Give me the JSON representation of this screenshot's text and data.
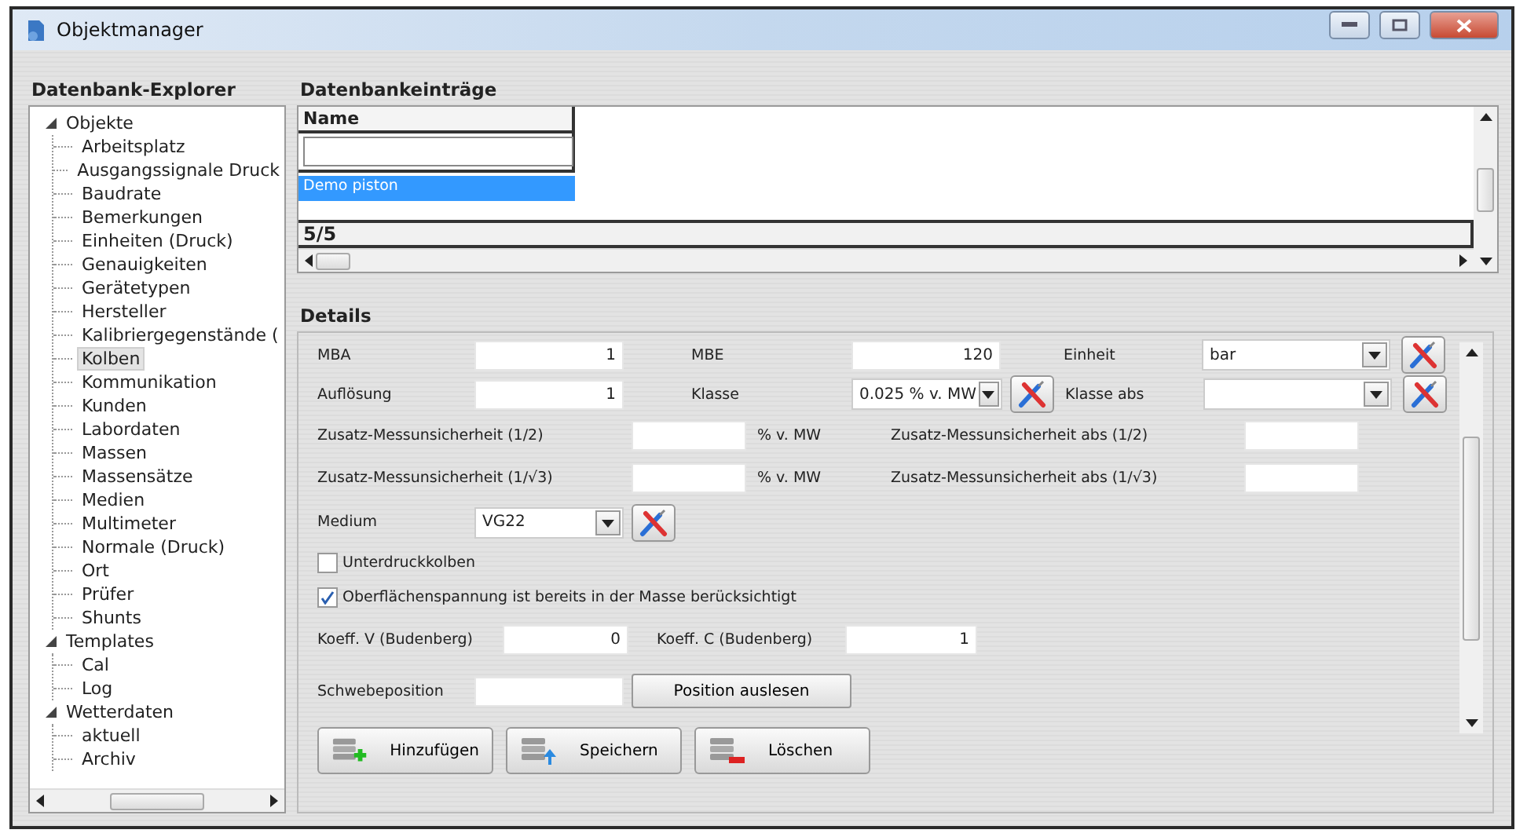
{
  "window": {
    "title": "Objektmanager"
  },
  "explorer": {
    "title": "Datenbank-Explorer",
    "tree": [
      {
        "label": "Objekte",
        "expanded": true,
        "selected": false,
        "children": [
          {
            "label": "Arbeitsplatz",
            "selected": false
          },
          {
            "label": "Ausgangssignale Druck",
            "selected": false
          },
          {
            "label": "Baudrate",
            "selected": false
          },
          {
            "label": "Bemerkungen",
            "selected": false
          },
          {
            "label": "Einheiten (Druck)",
            "selected": false
          },
          {
            "label": "Genauigkeiten",
            "selected": false
          },
          {
            "label": "Gerätetypen",
            "selected": false
          },
          {
            "label": "Hersteller",
            "selected": false
          },
          {
            "label": "Kalibriergegenstände (",
            "selected": false
          },
          {
            "label": "Kolben",
            "selected": true
          },
          {
            "label": "Kommunikation",
            "selected": false
          },
          {
            "label": "Kunden",
            "selected": false
          },
          {
            "label": "Labordaten",
            "selected": false
          },
          {
            "label": "Massen",
            "selected": false
          },
          {
            "label": "Massensätze",
            "selected": false
          },
          {
            "label": "Medien",
            "selected": false
          },
          {
            "label": "Multimeter",
            "selected": false
          },
          {
            "label": "Normale (Druck)",
            "selected": false
          },
          {
            "label": "Ort",
            "selected": false
          },
          {
            "label": "Prüfer",
            "selected": false
          },
          {
            "label": "Shunts",
            "selected": false
          }
        ]
      },
      {
        "label": "Templates",
        "expanded": true,
        "selected": false,
        "children": [
          {
            "label": "Cal",
            "selected": false
          },
          {
            "label": "Log",
            "selected": false
          }
        ]
      },
      {
        "label": "Wetterdaten",
        "expanded": true,
        "selected": false,
        "children": [
          {
            "label": "aktuell",
            "selected": false
          },
          {
            "label": "Archiv",
            "selected": false
          }
        ]
      }
    ]
  },
  "entries": {
    "title": "Datenbankeinträge",
    "columns": [
      "Name"
    ],
    "rows": [
      {
        "name": "Demo piston",
        "selected": true
      }
    ],
    "counter": "5/5"
  },
  "details": {
    "title": "Details",
    "mba": {
      "label": "MBA",
      "value": "1"
    },
    "mbe": {
      "label": "MBE",
      "value": "120"
    },
    "einheit": {
      "label": "Einheit",
      "value": "bar"
    },
    "aufloesung": {
      "label": "Auflösung",
      "value": "1"
    },
    "klasse": {
      "label": "Klasse",
      "value": "0.025 % v. MW"
    },
    "klasse_abs": {
      "label": "Klasse abs"
    },
    "zusatz_1": {
      "label": "Zusatz-Messunsicherheit (1/2)",
      "unit": "% v. MW"
    },
    "zusatz_abs_1": {
      "label": "Zusatz-Messunsicherheit abs (1/2)"
    },
    "zusatz_2": {
      "label": "Zusatz-Messunsicherheit (1/√3)",
      "unit": "% v. MW"
    },
    "zusatz_abs_2": {
      "label": "Zusatz-Messunsicherheit abs (1/√3)"
    },
    "medium": {
      "label": "Medium",
      "value": "VG22"
    },
    "checkboxes": [
      {
        "label": "Unterdruckkolben",
        "checked": false
      },
      {
        "label": "Oberflächenspannung ist bereits in der Masse berücksichtigt",
        "checked": true
      }
    ],
    "koeff_v": {
      "label": "Koeff. V (Budenberg)",
      "value": "0"
    },
    "koeff_c": {
      "label": "Koeff. C (Budenberg)",
      "value": "1"
    },
    "schwebeposition": {
      "label": "Schwebeposition"
    },
    "read_button": "Position auslesen",
    "actions": [
      {
        "label": "Hinzufügen",
        "kind": "add"
      },
      {
        "label": "Speichern",
        "kind": "save"
      },
      {
        "label": "Löschen",
        "kind": "delete"
      }
    ]
  }
}
